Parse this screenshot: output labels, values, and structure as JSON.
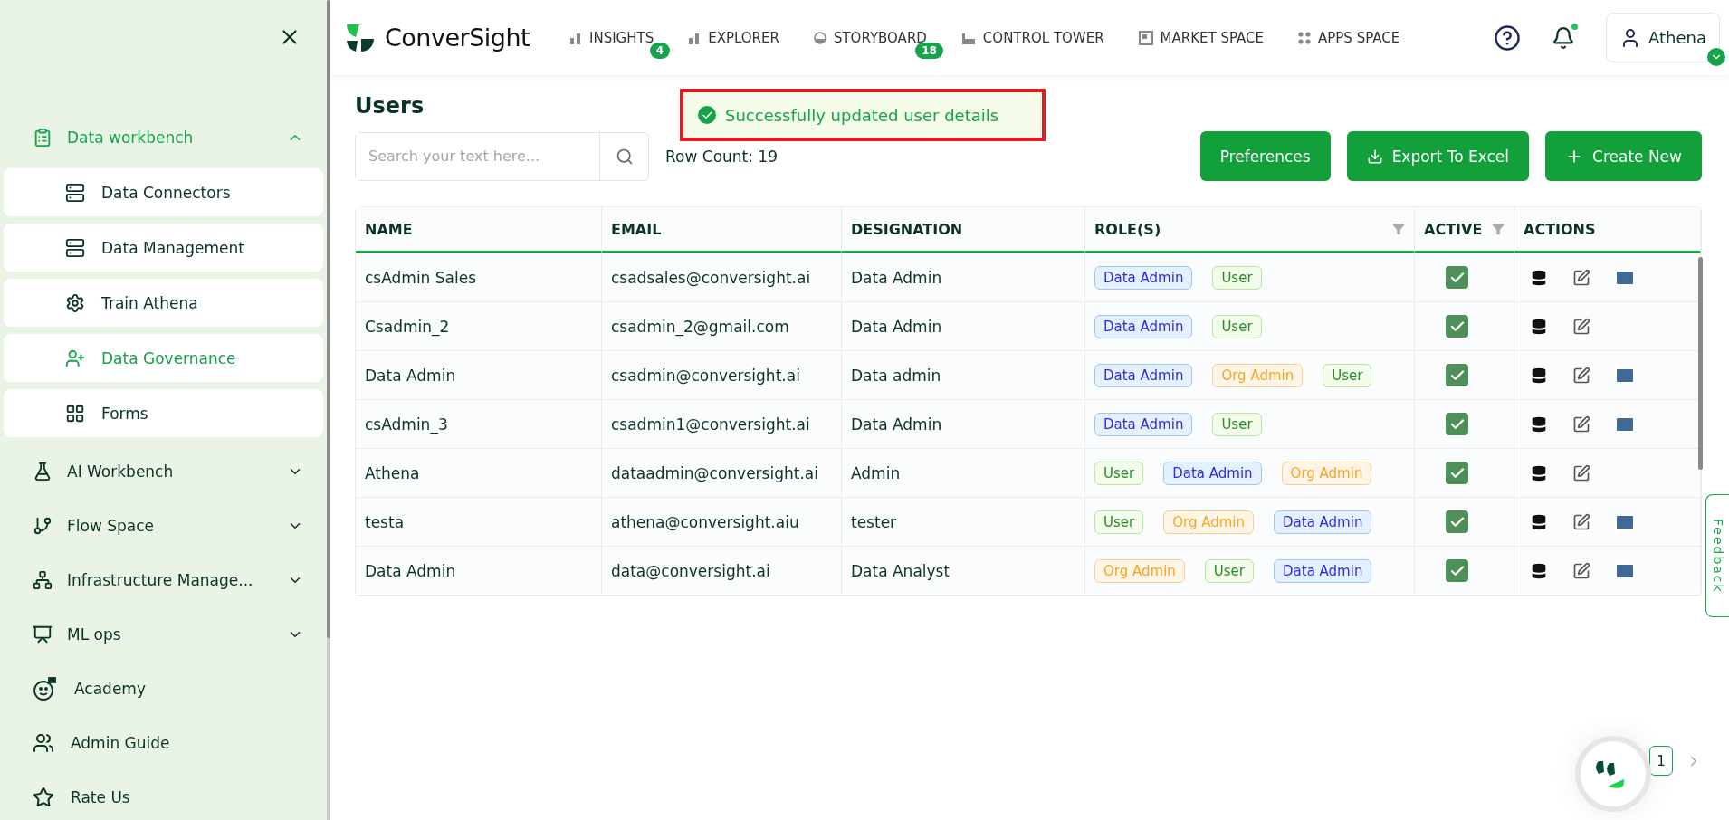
{
  "sidebar": {
    "groups": [
      {
        "label": "Data workbench",
        "expanded": true,
        "selected": true,
        "children": [
          {
            "label": "Data Connectors",
            "selected": false
          },
          {
            "label": "Data Management",
            "selected": false
          },
          {
            "label": "Train Athena",
            "selected": false
          },
          {
            "label": "Data Governance",
            "selected": true
          },
          {
            "label": "Forms",
            "selected": false
          }
        ]
      },
      {
        "label": "AI Workbench",
        "expanded": false,
        "selected": false
      },
      {
        "label": "Flow Space",
        "expanded": false,
        "selected": false
      },
      {
        "label": "Infrastructure Manage...",
        "expanded": false,
        "selected": false
      },
      {
        "label": "ML ops",
        "expanded": false,
        "selected": false
      }
    ],
    "footer": [
      {
        "label": "Academy"
      },
      {
        "label": "Admin Guide"
      },
      {
        "label": "Rate Us"
      }
    ]
  },
  "header": {
    "logo": "ConverSight",
    "nav": [
      {
        "label": "INSIGHTS",
        "count": "4"
      },
      {
        "label": "EXPLORER"
      },
      {
        "label": "STORYBOARD",
        "count": "18"
      },
      {
        "label": "CONTROL TOWER"
      },
      {
        "label": "MARKET SPACE"
      },
      {
        "label": "APPS SPACE"
      }
    ],
    "notifications_unread": true,
    "user": "Athena"
  },
  "toast": {
    "message": "Successfully updated user details"
  },
  "page": {
    "title": "Users",
    "search": {
      "placeholder": "Search your text here..."
    },
    "row_count": "Row Count: 19",
    "buttons": [
      "Preferences",
      "Export To Excel",
      "Create New"
    ]
  },
  "table": {
    "columns": [
      {
        "label": "NAME"
      },
      {
        "label": "EMAIL"
      },
      {
        "label": "DESIGNATION"
      },
      {
        "label": "ROLE(S)",
        "filter": true
      },
      {
        "label": "ACTIVE",
        "filter": true
      },
      {
        "label": "ACTIONS"
      }
    ],
    "rows": [
      {
        "name": "csAdmin Sales",
        "email": "csadsales@conversight.ai",
        "designation": "Data Admin",
        "roles": [
          {
            "label": "Data Admin",
            "kind": "data"
          },
          {
            "label": "User",
            "kind": "user"
          }
        ],
        "active": true,
        "can_email": true
      },
      {
        "name": "Csadmin_2",
        "email": "csadmin_2@gmail.com",
        "designation": "Data Admin",
        "roles": [
          {
            "label": "Data Admin",
            "kind": "data"
          },
          {
            "label": "User",
            "kind": "user"
          }
        ],
        "active": true,
        "can_email": false
      },
      {
        "name": "Data Admin",
        "email": "csadmin@conversight.ai",
        "designation": "Data admin",
        "roles": [
          {
            "label": "Data Admin",
            "kind": "data"
          },
          {
            "label": "Org Admin",
            "kind": "org"
          },
          {
            "label": "User",
            "kind": "user"
          }
        ],
        "active": true,
        "can_email": true
      },
      {
        "name": "csAdmin_3",
        "email": "csadmin1@conversight.ai",
        "designation": "Data Admin",
        "roles": [
          {
            "label": "Data Admin",
            "kind": "data"
          },
          {
            "label": "User",
            "kind": "user"
          }
        ],
        "active": true,
        "can_email": true
      },
      {
        "name": "Athena",
        "email": "dataadmin@conversight.ai",
        "designation": "Admin",
        "roles": [
          {
            "label": "User",
            "kind": "user"
          },
          {
            "label": "Data Admin",
            "kind": "data"
          },
          {
            "label": "Org Admin",
            "kind": "org"
          }
        ],
        "active": true,
        "can_email": false
      },
      {
        "name": "testa",
        "email": "athena@conversight.aiu",
        "designation": "tester",
        "roles": [
          {
            "label": "User",
            "kind": "user"
          },
          {
            "label": "Org Admin",
            "kind": "org"
          },
          {
            "label": "Data Admin",
            "kind": "data"
          }
        ],
        "active": true,
        "can_email": true
      },
      {
        "name": "Data Admin",
        "email": "data@conversight.ai",
        "designation": "Data Analyst",
        "roles": [
          {
            "label": "Org Admin",
            "kind": "org"
          },
          {
            "label": "User",
            "kind": "user"
          },
          {
            "label": "Data Admin",
            "kind": "data"
          }
        ],
        "active": true,
        "can_email": true
      }
    ]
  },
  "pagination": {
    "pages": [
      {
        "label": "1",
        "selected": true
      }
    ]
  },
  "feedback": "Feedback"
}
